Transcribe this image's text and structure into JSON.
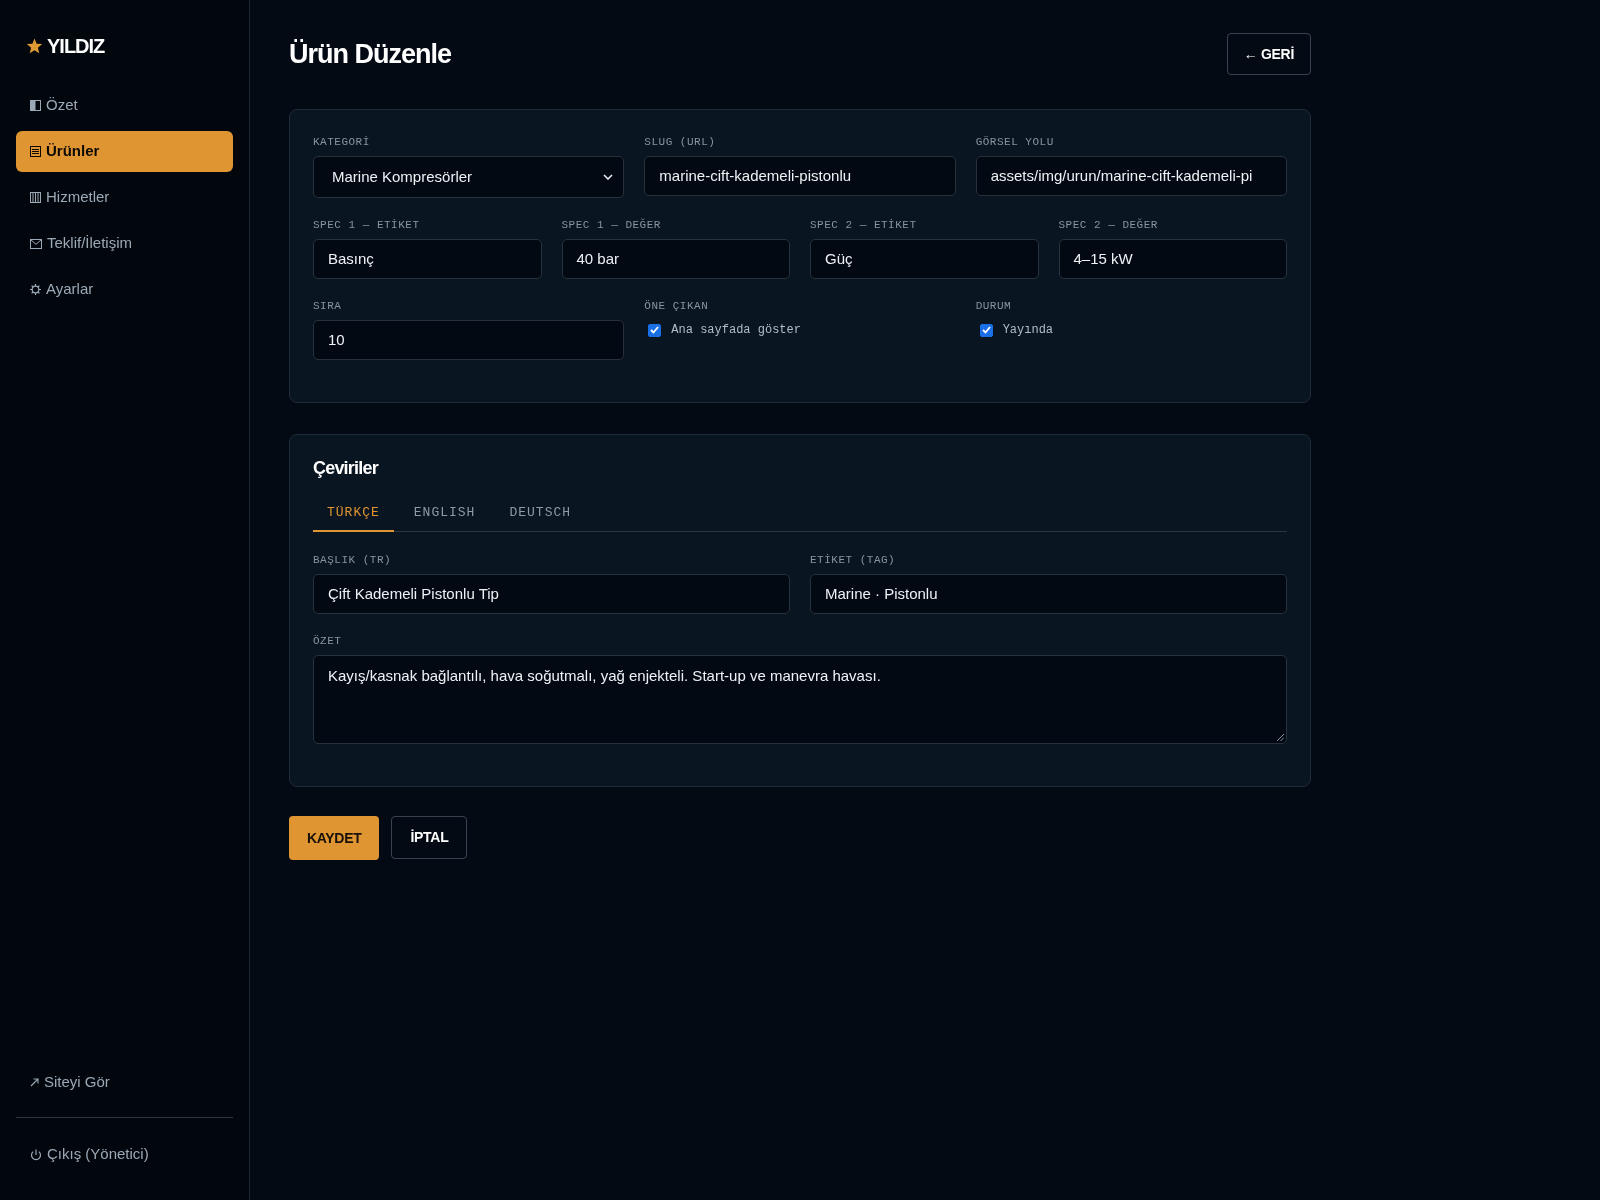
{
  "sidebar": {
    "logo": "YILDIZ",
    "nav_items": [
      {
        "label": "Özet",
        "selected": false
      },
      {
        "label": "Ürünler",
        "selected": true
      },
      {
        "label": "Hizmetler",
        "selected": false
      },
      {
        "label": "Teklif/İletişim",
        "selected": false
      },
      {
        "label": "Ayarlar",
        "selected": false
      }
    ],
    "footer_links": [
      {
        "label": "Siteyi Gör"
      },
      {
        "label": "Çıkış (Yönetici)"
      }
    ]
  },
  "header": {
    "title": "Ürün Düzenle",
    "back_button": "← GERİ"
  },
  "general": {
    "rows": [
      {
        "fields": [
          {
            "kind": "select",
            "label": "KATEGORİ",
            "value": "Marine Kompresörler"
          },
          {
            "kind": "text",
            "label": "SLUG (URL)",
            "value": "marine-cift-kademeli-pistonlu"
          },
          {
            "kind": "text",
            "label": "GÖRSEL YOLU",
            "value": "assets/img/urun/marine-cift-kademeli-pi"
          }
        ]
      },
      {
        "fields": [
          {
            "kind": "text",
            "label": "SPEC 1 — ETİKET",
            "value": "Basınç"
          },
          {
            "kind": "text",
            "label": "SPEC 1 — DEĞER",
            "value": "40 bar"
          },
          {
            "kind": "text",
            "label": "SPEC 2 — ETİKET",
            "value": "Güç"
          },
          {
            "kind": "text",
            "label": "SPEC 2 — DEĞER",
            "value": "4–15 kW"
          }
        ]
      },
      {
        "fields": [
          {
            "kind": "text",
            "label": "SIRA",
            "value": "10"
          },
          {
            "kind": "checkbox",
            "label": "ÖNE ÇIKAN",
            "option": "Ana sayfada göster",
            "checked": true
          },
          {
            "kind": "checkbox",
            "label": "DURUM",
            "option": "Yayında",
            "checked": true
          }
        ]
      }
    ]
  },
  "translations": {
    "title": "Çeviriler",
    "tabs": [
      {
        "label": "TÜRKÇE",
        "selected": true
      },
      {
        "label": "ENGLISH",
        "selected": false
      },
      {
        "label": "DEUTSCH",
        "selected": false
      }
    ],
    "fields": [
      {
        "label": "BAŞLIK (TR)",
        "value": "Çift Kademeli Pistonlu Tip"
      },
      {
        "label": "ETİKET (TAG)",
        "value": "Marine · Pistonlu"
      }
    ],
    "summary": {
      "label": "ÖZET",
      "value": "Kayış/kasnak bağlantılı, hava soğutmalı, yağ enjekteli. Start-up ve manevra havası."
    }
  },
  "actions": [
    {
      "kind": "primary",
      "label": "KAYDET"
    },
    {
      "kind": "secondary",
      "label": "İPTAL"
    }
  ]
}
